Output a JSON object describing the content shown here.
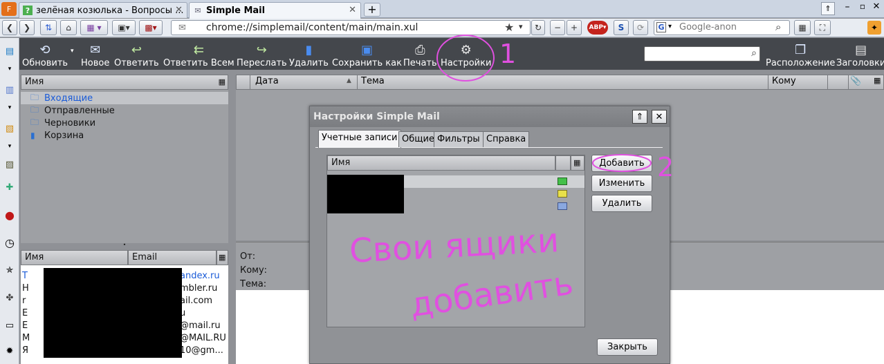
{
  "browser": {
    "tabs": [
      {
        "title": "зелёная козюлька - Вопросы ..."
      },
      {
        "title": "Simple Mail"
      }
    ],
    "url": "chrome://simplemail/content/main/main.xul",
    "search_placeholder": "Google-anon"
  },
  "toolbar": {
    "refresh": "Обновить",
    "new": "Новое",
    "reply": "Ответить",
    "reply_all": "Ответить Всем",
    "forward": "Переслать",
    "delete": "Удалить",
    "save_as": "Сохранить как",
    "print": "Печать",
    "settings": "Настройки",
    "layout": "Расположение",
    "headers": "Заголовки"
  },
  "folders": {
    "column_name": "Имя",
    "items": [
      {
        "label": "Входящие"
      },
      {
        "label": "Отправленные"
      },
      {
        "label": "Черновики"
      },
      {
        "label": "Корзина"
      }
    ]
  },
  "contacts": {
    "col_name": "Имя",
    "col_email": "Email",
    "rows": [
      {
        "name": "T",
        "email": "andex.ru"
      },
      {
        "name": "H",
        "email": "mbler.ru"
      },
      {
        "name": "r",
        "email": "ail.com"
      },
      {
        "name": "E",
        "email": "u"
      },
      {
        "name": "E",
        "email": "@mail.ru"
      },
      {
        "name": "M",
        "email": "@MAIL.RU"
      },
      {
        "name": "Я",
        "email": "10@gm..."
      }
    ]
  },
  "message_list": {
    "col_date": "Дата",
    "col_subject": "Тема",
    "col_to": "Кому"
  },
  "message_header": {
    "from": "От:",
    "to": "Кому:",
    "subject": "Тема:"
  },
  "dialog": {
    "title": "Настройки Simple Mail",
    "tabs": [
      {
        "label": "Учетные записи"
      },
      {
        "label": "Общие"
      },
      {
        "label": "Фильтры"
      },
      {
        "label": "Справка"
      }
    ],
    "accounts_col_name": "Имя",
    "add": "Добавить",
    "edit": "Изменить",
    "remove": "Удалить",
    "close": "Закрыть"
  },
  "annotations": {
    "one": "1",
    "two": "2",
    "note_line1": "Свои ящики",
    "note_line2": "добавить",
    "color": "#e050e0"
  }
}
